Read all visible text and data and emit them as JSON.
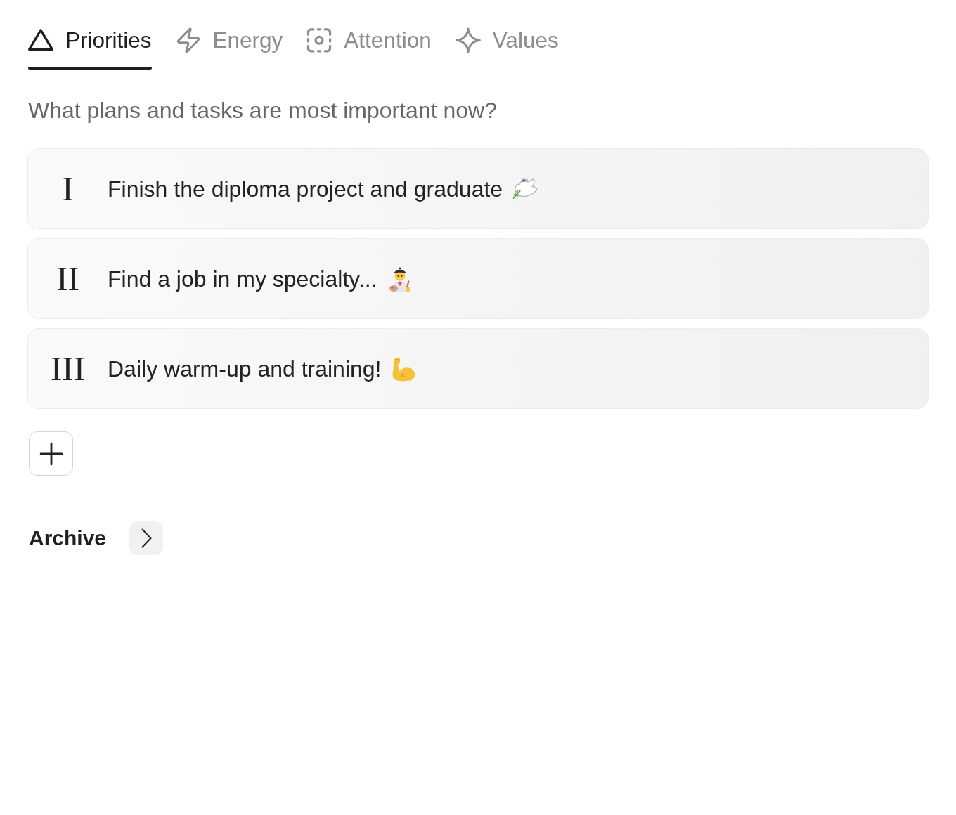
{
  "tabs": [
    {
      "label": "Priorities",
      "kind": "triangle",
      "selected": true
    },
    {
      "label": "Energy",
      "kind": "bolt",
      "selected": false
    },
    {
      "label": "Attention",
      "kind": "focus",
      "selected": false
    },
    {
      "label": "Values",
      "kind": "sparkle",
      "selected": false
    }
  ],
  "prompt": "What plans and tasks are most important now?",
  "priorities": [
    {
      "numeral": "I",
      "text": "Finish the diploma project and graduate",
      "kind": "dove"
    },
    {
      "numeral": "II",
      "text": "Find a job in my specialty...",
      "kind": "artist"
    },
    {
      "numeral": "III",
      "text": "Daily warm-up and training!",
      "kind": "muscle"
    }
  ],
  "archive": {
    "title": "Archive",
    "expanded": false
  }
}
